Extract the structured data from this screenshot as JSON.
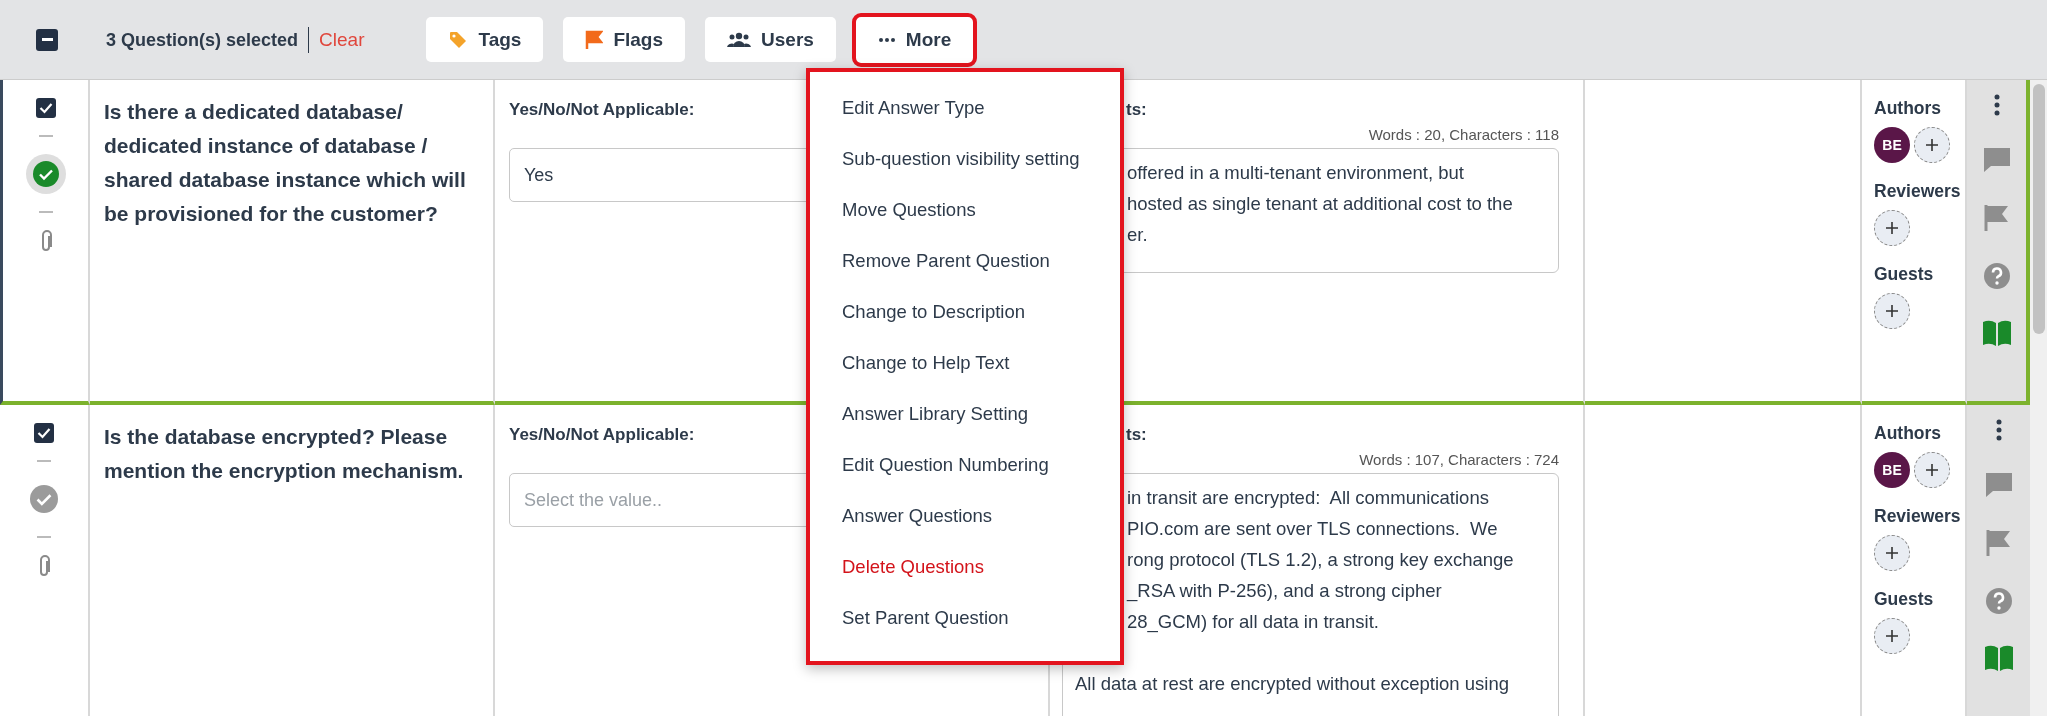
{
  "toolbar": {
    "select_all_mixed": true,
    "selection_count": "3 Question(s) selected",
    "clear": "Clear",
    "buttons": [
      {
        "kind": "tags",
        "label": "Tags",
        "highlighted": false
      },
      {
        "kind": "flags",
        "label": "Flags",
        "highlighted": false
      },
      {
        "kind": "users",
        "label": "Users",
        "highlighted": false
      },
      {
        "kind": "more",
        "label": "More",
        "highlighted": true
      }
    ]
  },
  "more_menu": {
    "items": [
      {
        "label": "Edit Answer Type",
        "danger": false
      },
      {
        "label": "Sub-question visibility setting",
        "danger": false
      },
      {
        "label": "Move Questions",
        "danger": false
      },
      {
        "label": "Remove Parent Question",
        "danger": false
      },
      {
        "label": "Change to Description",
        "danger": false
      },
      {
        "label": "Change to Help Text",
        "danger": false
      },
      {
        "label": "Answer Library Setting",
        "danger": false
      },
      {
        "label": "Edit Question Numbering",
        "danger": false
      },
      {
        "label": "Answer Questions",
        "danger": false
      },
      {
        "label": "Delete Questions",
        "danger": true
      },
      {
        "label": "Set Parent Question",
        "danger": false
      }
    ]
  },
  "questions": [
    {
      "checked": true,
      "focused": true,
      "answered": true,
      "question": "Is there a dedicated database/ dedicated instance of database / shared database instance which will be provisioned for the customer?",
      "answer_label": "Yes/No/Not Applicable:",
      "answer": {
        "value": "Yes"
      },
      "comments": {
        "label": "ts:",
        "counter": "Words : 20, Characters : 118",
        "covered_lines": [
          "offered in a multi-tenant environment, but",
          "hosted as single tenant at additional cost to the",
          "er."
        ]
      },
      "users": [
        {
          "label": "Authors",
          "avatars": [
            "BE"
          ]
        },
        {
          "label": "Reviewers"
        },
        {
          "label": "Guests"
        }
      ]
    },
    {
      "checked": true,
      "focused": false,
      "answered": false,
      "question": "Is the database encrypted? Please mention the encryption mechanism.",
      "answer_label": "Yes/No/Not Applicable:",
      "answer": {
        "placeholder": "Select the value.."
      },
      "comments": {
        "label": "ts:",
        "counter": "Words : 107, Characters : 724",
        "covered_lines": [
          "in transit are encrypted:  All communications",
          "PIO.com are sent over TLS connections.  We",
          "rong protocol (TLS 1.2), a strong key exchange",
          "_RSA with P-256), and a strong cipher",
          "28_GCM) for all data in transit."
        ],
        "lines": [
          "All data at rest are encrypted without exception using"
        ]
      },
      "users": [
        {
          "label": "Authors",
          "avatars": [
            "BE"
          ]
        },
        {
          "label": "Reviewers"
        },
        {
          "label": "Guests"
        }
      ]
    }
  ]
}
